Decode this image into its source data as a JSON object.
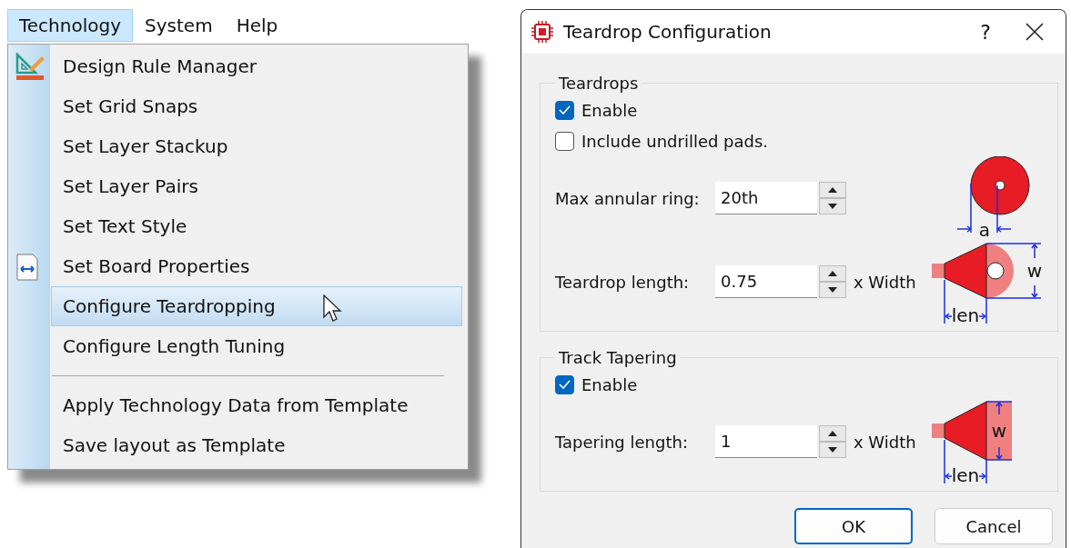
{
  "menu_bar": {
    "items": [
      {
        "label": "Technology",
        "selected": true
      },
      {
        "label": "System",
        "selected": false
      },
      {
        "label": "Help",
        "selected": false
      }
    ]
  },
  "menu": {
    "items": [
      {
        "kind": "item",
        "label": "Design Rule Manager",
        "highlighted": false
      },
      {
        "kind": "item",
        "label": "Set Grid Snaps",
        "highlighted": false
      },
      {
        "kind": "item",
        "label": "Set Layer Stackup",
        "highlighted": false
      },
      {
        "kind": "item",
        "label": "Set Layer Pairs",
        "highlighted": false
      },
      {
        "kind": "item",
        "label": "Set Text Style",
        "highlighted": false
      },
      {
        "kind": "item",
        "label": "Set Board Properties",
        "highlighted": false
      },
      {
        "kind": "item",
        "label": "Configure Teardropping",
        "highlighted": true
      },
      {
        "kind": "item",
        "label": "Configure Length Tuning",
        "highlighted": false
      },
      {
        "kind": "separator"
      },
      {
        "kind": "item",
        "label": "Apply Technology Data from Template",
        "highlighted": false
      },
      {
        "kind": "item",
        "label": "Save layout as Template",
        "highlighted": false
      }
    ]
  },
  "dialog": {
    "title": "Teardrop Configuration",
    "help": "?",
    "groups": [
      {
        "title": "Teardrops",
        "rows": [
          {
            "kind": "checkbox",
            "label": "Enable",
            "checked": true
          },
          {
            "kind": "checkbox",
            "label": "Include undrilled pads.",
            "checked": false
          },
          {
            "kind": "spin",
            "label": "Max annular ring:",
            "value": "20th",
            "diagram": {
              "kind": "pad",
              "labels": [
                "a"
              ]
            }
          },
          {
            "kind": "spin",
            "label": "Teardrop length:",
            "value": "0.75",
            "suffix": "x Width",
            "diagram": {
              "kind": "teardrop",
              "labels": [
                "w",
                "len"
              ]
            }
          }
        ]
      },
      {
        "title": "Track Tapering",
        "rows": [
          {
            "kind": "checkbox",
            "label": "Enable",
            "checked": true
          },
          {
            "kind": "spin",
            "label": "Tapering length:",
            "value": "1",
            "suffix": "x Width",
            "diagram": {
              "kind": "taper",
              "labels": [
                "w",
                "len"
              ]
            }
          }
        ]
      }
    ],
    "buttons": [
      {
        "label": "OK",
        "default": true
      },
      {
        "label": "Cancel",
        "default": false
      }
    ]
  }
}
